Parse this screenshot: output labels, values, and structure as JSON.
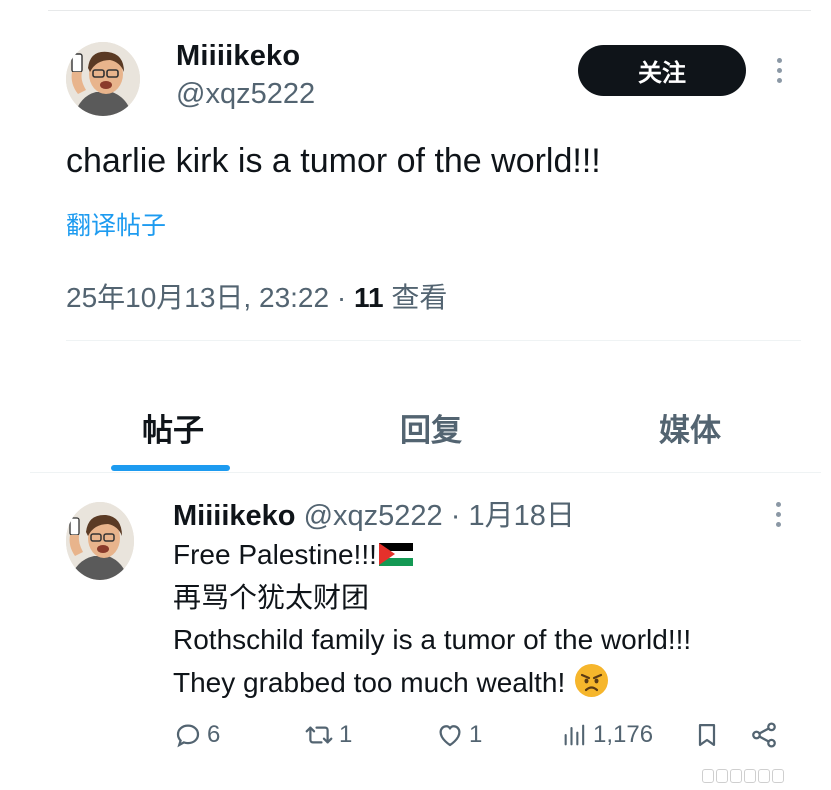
{
  "tweet": {
    "author": {
      "display_name": "Miiiikeko",
      "handle": "@xqz5222",
      "avatar_icon": "cartoon-man-holding-phone-avatar"
    },
    "follow_label": "关注",
    "text": "charlie kirk is a tumor of the world!!!",
    "translate_label": "翻译帖子",
    "timestamp": "25年10月13日, 23:22",
    "separator": "·",
    "views_count": "11",
    "views_label": "查看"
  },
  "tabs": [
    {
      "label": "帖子",
      "active": true
    },
    {
      "label": "回复",
      "active": false
    },
    {
      "label": "媒体",
      "active": false
    }
  ],
  "reply_post": {
    "author": {
      "display_name": "Miiiikeko",
      "handle": "@xqz5222",
      "avatar_icon": "cartoon-man-holding-phone-avatar"
    },
    "separator": "·",
    "date": "1月18日",
    "lines": [
      "Free Palestine!!!",
      "再骂个犹太财团",
      "Rothschild family is a tumor of the world!!!",
      "They grabbed too much wealth!"
    ],
    "emoji": [
      "palestine-flag",
      "angry-face"
    ],
    "stats": {
      "replies": "6",
      "reposts": "1",
      "likes": "1",
      "views": "1,176"
    }
  },
  "colors": {
    "accent": "#1d9bf0",
    "text_primary": "#0f1419",
    "text_secondary": "#536471",
    "follow_button_bg": "#0f1419"
  }
}
